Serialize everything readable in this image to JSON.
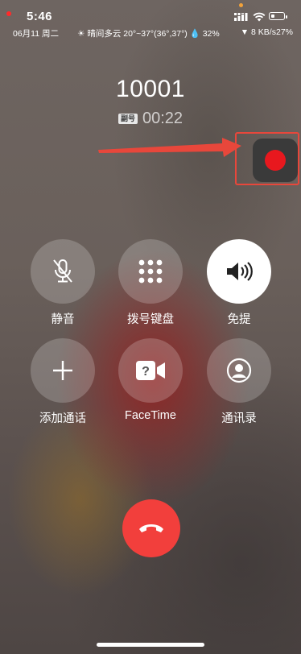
{
  "status_bar": {
    "time": "5:46",
    "date": "06月11 周二",
    "weather": "☀ 晴间多云 20°~37°(36°,37°) 💧 32%",
    "network_speed": "▼ 8 KB/s27%",
    "battery_level": 0.27
  },
  "call": {
    "number": "10001",
    "sim_badge": "副号",
    "duration": "00:22"
  },
  "controls": [
    {
      "label": "静音",
      "icon": "mute-mic-icon"
    },
    {
      "label": "拨号键盘",
      "icon": "keypad-icon"
    },
    {
      "label": "免提",
      "icon": "speaker-icon",
      "active": true
    },
    {
      "label": "添加通话",
      "icon": "plus-icon"
    },
    {
      "label": "FaceTime",
      "icon": "facetime-video-icon"
    },
    {
      "label": "通讯录",
      "icon": "contacts-icon"
    }
  ],
  "colors": {
    "hangup": "#f23f3c",
    "record": "#e8181e",
    "annotation": "#e8473b"
  }
}
